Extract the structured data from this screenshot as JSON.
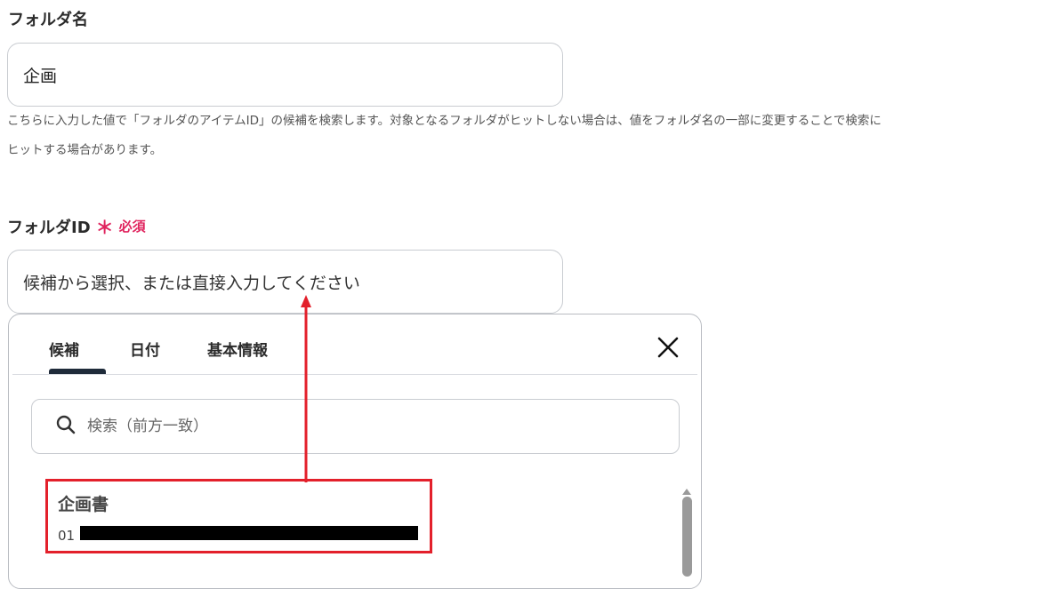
{
  "folder_name": {
    "label": "フォルダ名",
    "value": "企画",
    "help_line1": "こちらに入力した値で「フォルダのアイテムID」の候補を検索します。対象となるフォルダがヒットしない場合は、値をフォルダ名の一部に変更することで検索に",
    "help_line2": "ヒットする場合があります。"
  },
  "folder_id": {
    "label": "フォルダID",
    "required_star": "＊",
    "required_text": "必須",
    "placeholder": "候補から選択、または直接入力してください"
  },
  "popup": {
    "tabs": [
      "候補",
      "日付",
      "基本情報"
    ],
    "active_tab": "候補",
    "search_placeholder": "検索（前方一致）",
    "result": {
      "title": "企画書",
      "id_prefix": "01"
    }
  },
  "colors": {
    "required": "#e0245e",
    "highlight": "#e3202b",
    "tab_indicator": "#1f2b3a"
  },
  "icons": [
    "search-icon",
    "close-icon",
    "scroll-up-icon",
    "arrow-annotation"
  ]
}
